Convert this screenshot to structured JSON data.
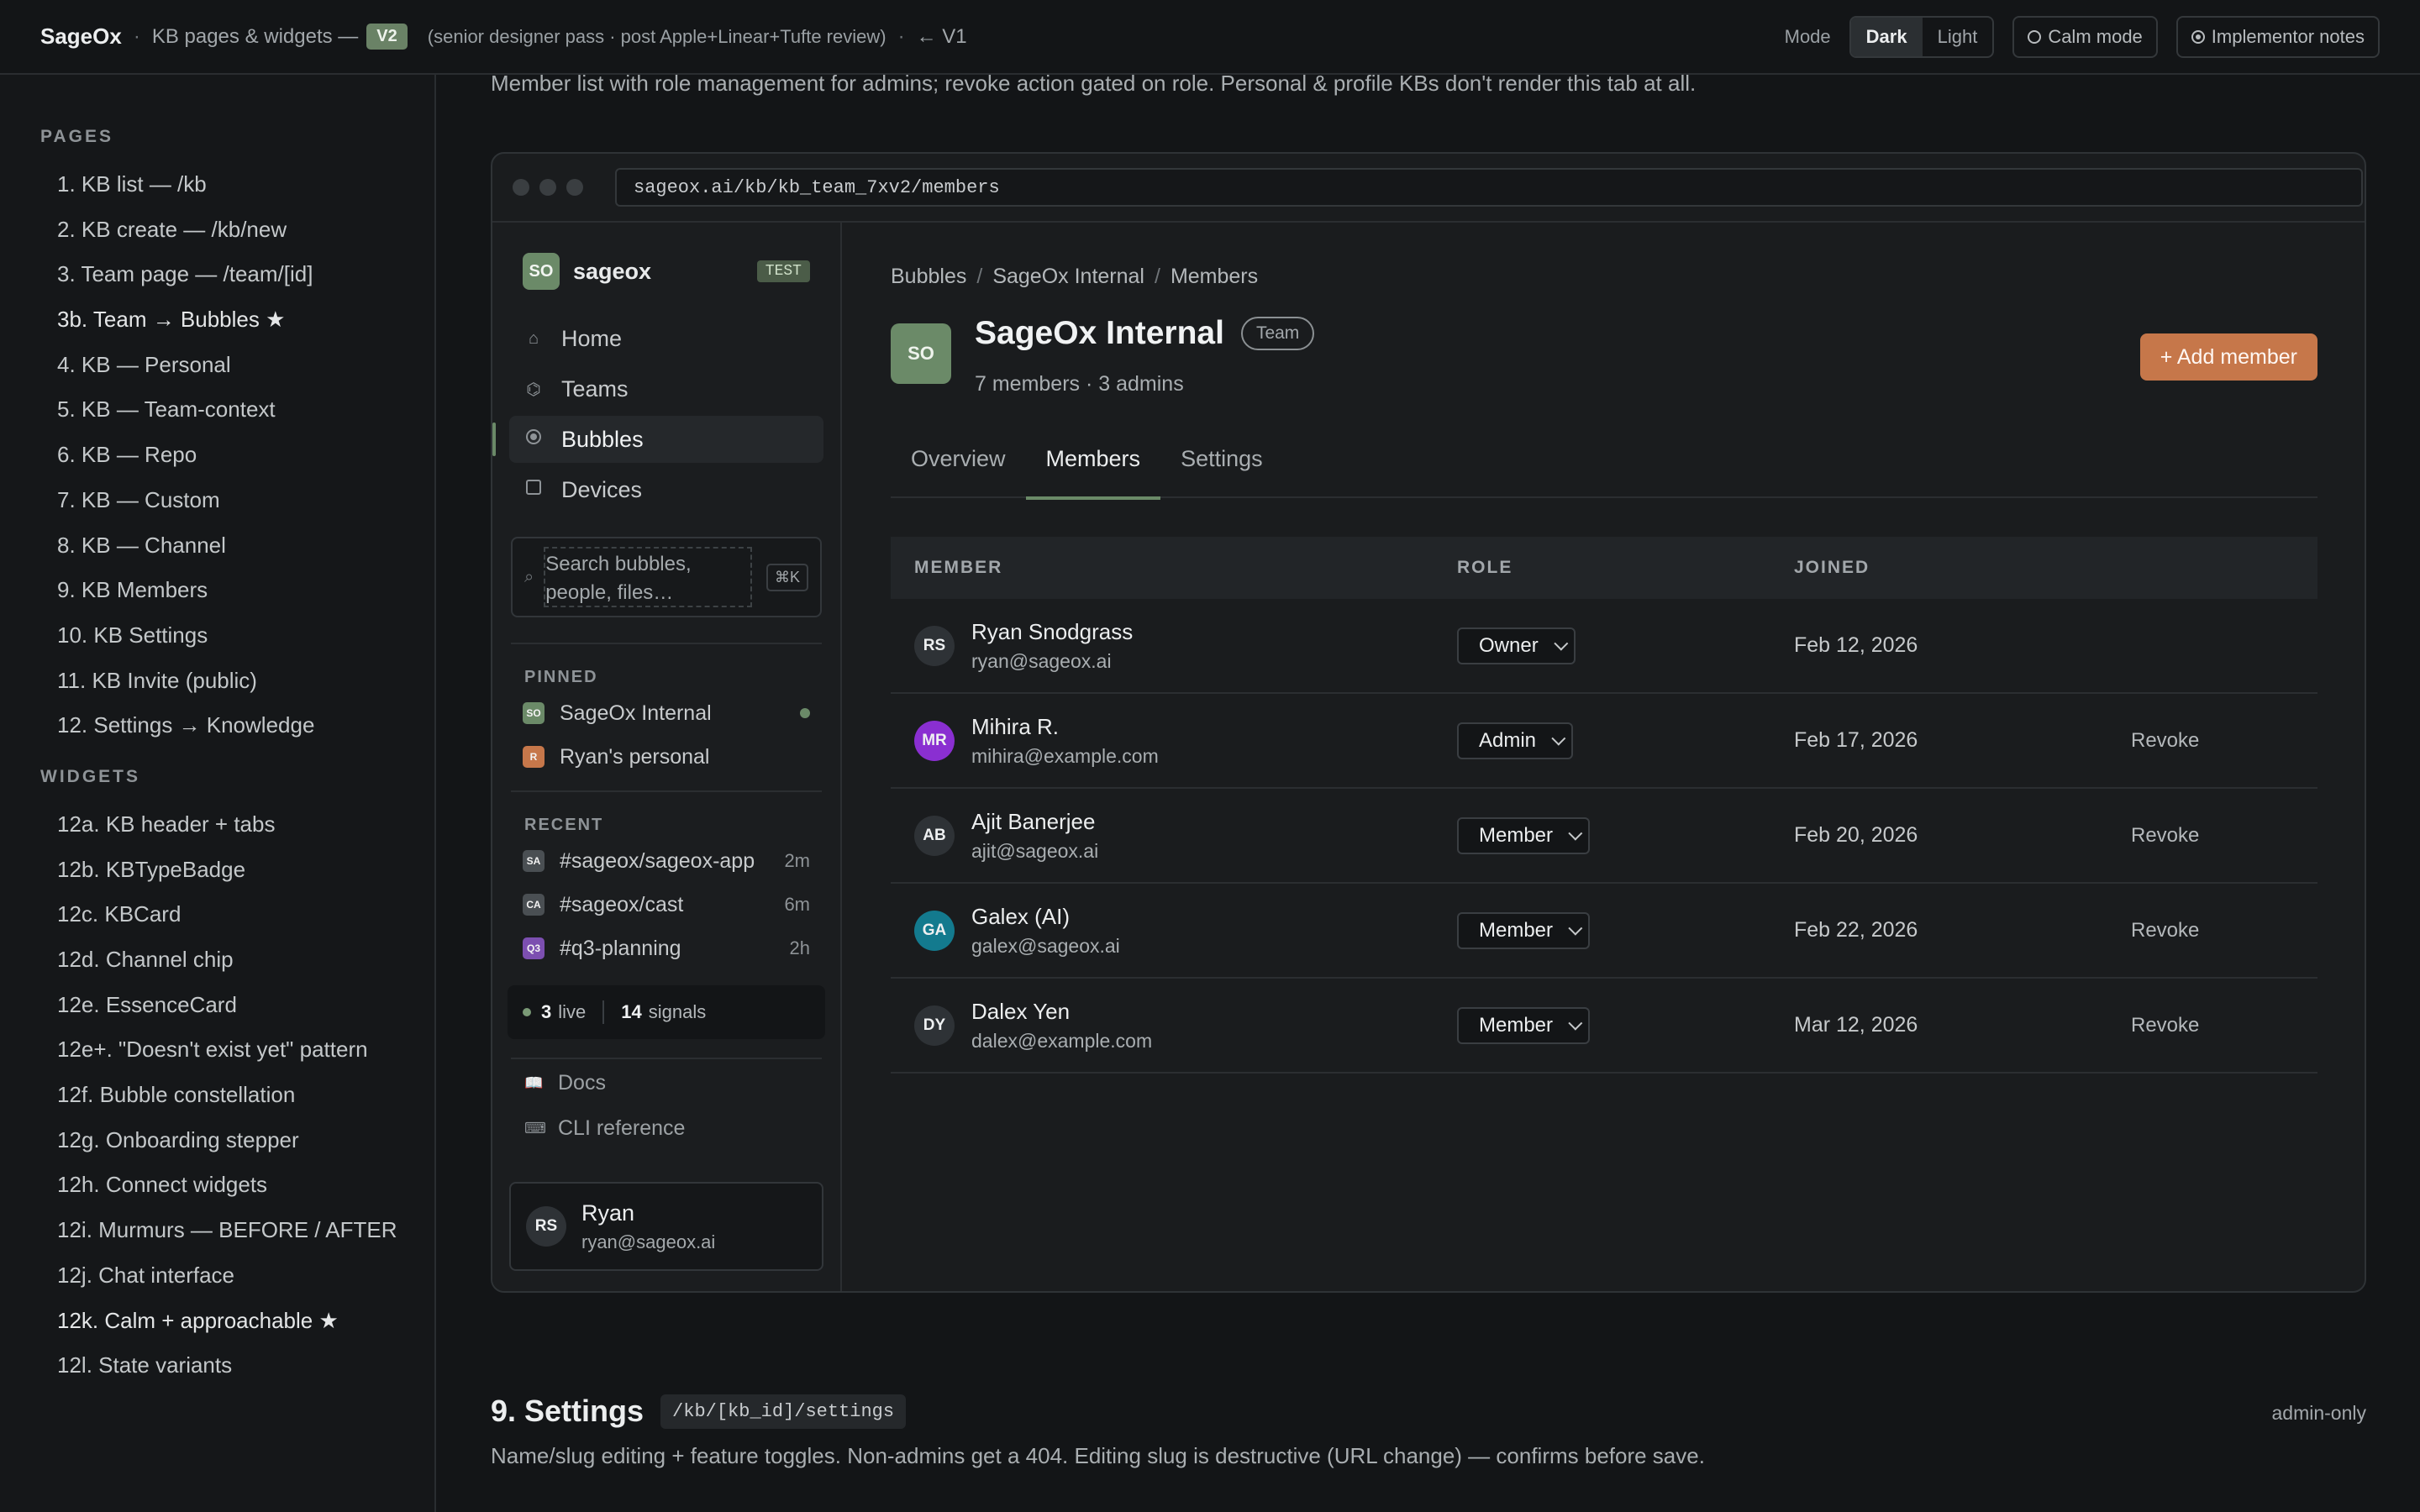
{
  "topbar": {
    "brand": "SageOx",
    "sep": "·",
    "subtitle": "KB pages & widgets —",
    "version": "V2",
    "note": "(senior designer pass · post Apple+Linear+Tufte review)",
    "back_link": "← V1",
    "mode_label": "Mode",
    "mode_dark": "Dark",
    "mode_light": "Light",
    "calm_mode": "Calm mode",
    "implementor_notes": "Implementor notes"
  },
  "leftnav": {
    "pages_heading": "PAGES",
    "pages": [
      "1. KB list — /kb",
      "2. KB create — /kb/new",
      "3. Team page — /team/[id]",
      "3b. Team → Bubbles ★",
      "4. KB — Personal",
      "5. KB — Team-context",
      "6. KB — Repo",
      "7. KB — Custom",
      "8. KB — Channel",
      "9. KB Members",
      "10. KB Settings",
      "11. KB Invite (public)",
      "12. Settings → Knowledge"
    ],
    "widgets_heading": "WIDGETS",
    "widgets": [
      "12a. KB header + tabs",
      "12b. KBTypeBadge",
      "12c. KBCard",
      "12d. Channel chip",
      "12e. EssenceCard",
      "12e+. \"Doesn't exist yet\" pattern",
      "12f. Bubble constellation",
      "12g. Onboarding stepper",
      "12h. Connect widgets",
      "12i. Murmurs — BEFORE / AFTER",
      "12j. Chat interface",
      "12k. Calm + approachable ★",
      "12l. State variants"
    ]
  },
  "intro": "Member list with role management for admins; revoke action gated on role. Personal & profile KBs don't render this tab at all.",
  "mock": {
    "url": "sageox.ai/kb/kb_team_7xv2/members",
    "workspace": {
      "badge": "SO",
      "name": "sageox",
      "env": "TEST"
    },
    "nav": [
      {
        "label": "Home",
        "icon": "home-icon",
        "glyph": "⌂"
      },
      {
        "label": "Teams",
        "icon": "teams-icon",
        "glyph": "⌬"
      },
      {
        "label": "Bubbles",
        "icon": "bubbles-icon",
        "glyph": ""
      },
      {
        "label": "Devices",
        "icon": "devices-icon",
        "glyph": ""
      }
    ],
    "search": {
      "icon": "⌕",
      "placeholder": "Search bubbles, people, files…",
      "shortcut": "⌘K"
    },
    "pinned_heading": "PINNED",
    "pinned": [
      {
        "badge": "SO",
        "label": "SageOx Internal",
        "color": "#6b8a68"
      },
      {
        "badge": "R",
        "label": "Ryan's personal",
        "color": "#c6774a"
      }
    ],
    "recent_heading": "RECENT",
    "recent": [
      {
        "badge": "SA",
        "label": "#sageox/sageox-app",
        "time": "2m",
        "color": "#4a4f53"
      },
      {
        "badge": "CA",
        "label": "#sageox/cast",
        "time": "6m",
        "color": "#4a4f53"
      },
      {
        "badge": "Q3",
        "label": "#q3-planning",
        "time": "2h",
        "color": "#7c4fb0"
      }
    ],
    "live": {
      "count": "3",
      "label": "live",
      "signals_count": "14",
      "signals_label": "signals"
    },
    "footer_links": [
      {
        "label": "Docs",
        "glyph": "📖"
      },
      {
        "label": "CLI reference",
        "glyph": "⌨"
      }
    ],
    "user": {
      "initials": "RS",
      "name": "Ryan",
      "email": "ryan@sageox.ai"
    },
    "breadcrumb": [
      "Bubbles",
      "SageOx Internal",
      "Members"
    ],
    "crumb_sep": "/",
    "kb": {
      "badge": "SO",
      "title": "SageOx Internal",
      "type": "Team",
      "meta": "7 members · 3 admins"
    },
    "add_member": "+ Add member",
    "tabs": [
      "Overview",
      "Members",
      "Settings"
    ],
    "table": {
      "headers": {
        "member": "MEMBER",
        "role": "ROLE",
        "joined": "JOINED"
      },
      "rows": [
        {
          "initials": "RS",
          "name": "Ryan Snodgrass",
          "email": "ryan@sageox.ai",
          "role": "Owner",
          "joined": "Feb 12, 2026",
          "action": "",
          "color": "#2e3236"
        },
        {
          "initials": "MR",
          "name": "Mihira R.",
          "email": "mihira@example.com",
          "role": "Admin",
          "joined": "Feb 17, 2026",
          "action": "Revoke",
          "color": "#8a2fd1"
        },
        {
          "initials": "AB",
          "name": "Ajit Banerjee",
          "email": "ajit@sageox.ai",
          "role": "Member",
          "joined": "Feb 20, 2026",
          "action": "Revoke",
          "color": "#2e3236"
        },
        {
          "initials": "GA",
          "name": "Galex (AI)",
          "email": "galex@sageox.ai",
          "role": "Member",
          "joined": "Feb 22, 2026",
          "action": "Revoke",
          "color": "#137a8e"
        },
        {
          "initials": "DY",
          "name": "Dalex Yen",
          "email": "dalex@example.com",
          "role": "Member",
          "joined": "Mar 12, 2026",
          "action": "Revoke",
          "color": "#2e3236"
        }
      ]
    }
  },
  "section9": {
    "title": "9. Settings",
    "path": "/kb/[kb_id]/settings",
    "tag": "admin-only",
    "desc": "Name/slug editing + feature toggles. Non-admins get a 404. Editing slug is destructive (URL change) — confirms before save."
  }
}
